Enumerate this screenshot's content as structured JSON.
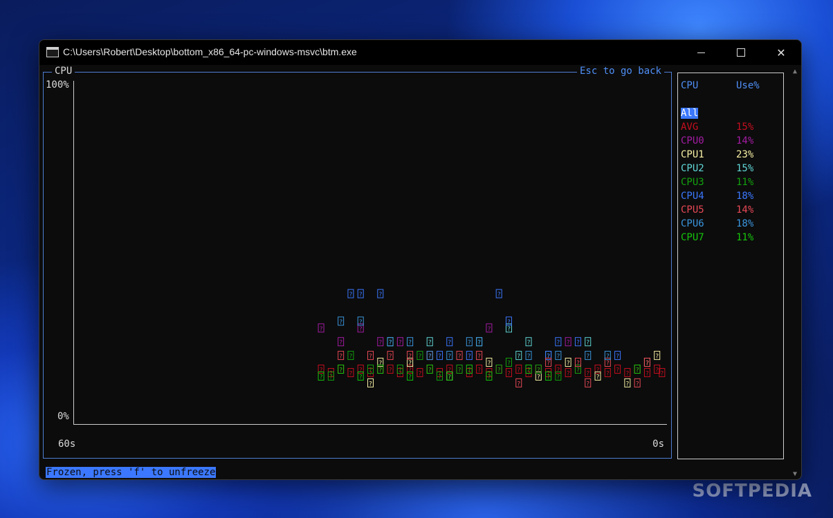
{
  "window": {
    "title": "C:\\Users\\Robert\\Desktop\\bottom_x86_64-pc-windows-msvc\\btm.exe"
  },
  "chart_panel": {
    "title": "CPU",
    "back_hint": "Esc to go back",
    "y_top_label": "100%",
    "y_bottom_label": "0%",
    "x_left_label": "60s",
    "x_right_label": "0s"
  },
  "legend": {
    "header_name": "CPU",
    "header_use": "Use%",
    "all_label": "All",
    "rows": [
      {
        "name": "AVG",
        "value": "15%",
        "color": "#c50f1f"
      },
      {
        "name": "CPU0",
        "value": "14%",
        "color": "#a51ca5"
      },
      {
        "name": "CPU1",
        "value": "23%",
        "color": "#f9f1a5"
      },
      {
        "name": "CPU2",
        "value": "15%",
        "color": "#61d6d6"
      },
      {
        "name": "CPU3",
        "value": "11%",
        "color": "#13a10e"
      },
      {
        "name": "CPU4",
        "value": "18%",
        "color": "#3b78ff"
      },
      {
        "name": "CPU5",
        "value": "14%",
        "color": "#e74856"
      },
      {
        "name": "CPU6",
        "value": "18%",
        "color": "#3a96dd"
      },
      {
        "name": "CPU7",
        "value": "11%",
        "color": "#16c60c"
      }
    ]
  },
  "status_bar": {
    "text": "Frozen, press 'f' to unfreeze"
  },
  "chart_data": {
    "type": "scatter",
    "x_range_seconds": [
      60,
      0
    ],
    "ylim": [
      0,
      100
    ],
    "y_unit": "%",
    "glyph": "?",
    "series_points": [
      {
        "series": "AVG",
        "t": [
          35,
          34,
          33,
          32,
          31,
          30,
          29,
          28,
          27,
          26,
          25,
          24,
          23,
          22,
          21,
          20,
          19,
          18,
          17,
          16,
          15,
          14,
          13,
          12,
          11,
          10,
          9,
          8,
          7,
          6,
          5,
          4,
          3,
          2,
          1,
          0.5
        ],
        "y": [
          16,
          15,
          16,
          15,
          16,
          15,
          16,
          16,
          15,
          16,
          15,
          16,
          15,
          16,
          16,
          15,
          16,
          15,
          16,
          15,
          16,
          15,
          16,
          15,
          16,
          15,
          16,
          15,
          16,
          15,
          16,
          15,
          16,
          15,
          16,
          15
        ]
      },
      {
        "series": "CPU0",
        "t": [
          35,
          33,
          31,
          29,
          27,
          18,
          10
        ],
        "y": [
          28,
          24,
          28,
          24,
          24,
          28,
          24
        ]
      },
      {
        "series": "CPU1",
        "t": [
          30,
          29,
          26,
          22,
          18,
          13,
          10,
          7,
          4,
          2,
          1
        ],
        "y": [
          12,
          18,
          18,
          14,
          18,
          14,
          18,
          14,
          12,
          18,
          20
        ]
      },
      {
        "series": "CPU2",
        "t": [
          28,
          24,
          19,
          16,
          15,
          14,
          12,
          8
        ],
        "y": [
          24,
          24,
          24,
          28,
          20,
          24,
          20,
          24
        ]
      },
      {
        "series": "CPU3",
        "t": [
          34,
          32,
          30,
          27,
          25,
          23,
          21,
          17,
          16,
          13,
          11,
          9
        ],
        "y": [
          14,
          20,
          16,
          16,
          20,
          14,
          16,
          16,
          18,
          16,
          14,
          16
        ]
      },
      {
        "series": "CPU4",
        "t": [
          32,
          31,
          29,
          23,
          22,
          20,
          17,
          16,
          12,
          11,
          9,
          5
        ],
        "y": [
          38,
          38,
          38,
          20,
          24,
          20,
          38,
          30,
          20,
          24,
          24,
          20
        ]
      },
      {
        "series": "CPU5",
        "t": [
          33,
          30,
          28,
          26,
          24,
          21,
          19,
          15,
          12,
          9,
          8,
          6,
          3,
          2
        ],
        "y": [
          20,
          20,
          20,
          20,
          20,
          20,
          20,
          12,
          18,
          18,
          12,
          18,
          12,
          18
        ]
      },
      {
        "series": "CPU6",
        "t": [
          33,
          31,
          28,
          26,
          24,
          22,
          20,
          19,
          14,
          11,
          8,
          6
        ],
        "y": [
          30,
          30,
          24,
          24,
          20,
          20,
          24,
          24,
          20,
          20,
          20,
          20
        ]
      },
      {
        "series": "CPU7",
        "t": [
          35,
          33,
          31,
          29,
          26,
          24,
          22,
          20,
          18,
          14,
          12,
          3
        ],
        "y": [
          14,
          16,
          14,
          16,
          14,
          16,
          14,
          16,
          14,
          16,
          14,
          16
        ]
      }
    ]
  }
}
